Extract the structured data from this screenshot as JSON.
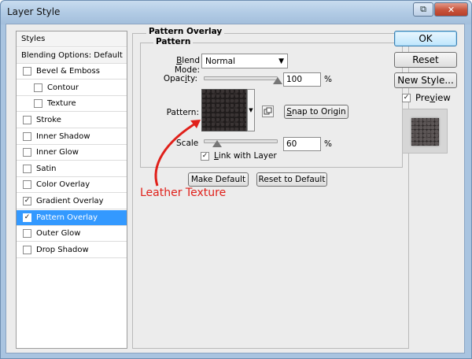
{
  "window": {
    "title": "Layer Style",
    "help_glyph": "⧉",
    "close_glyph": "✕"
  },
  "styles_list": {
    "items": [
      {
        "label": "Styles",
        "type": "header",
        "checked": false
      },
      {
        "label": "Blending Options: Default",
        "type": "header",
        "checked": false
      },
      {
        "label": "Bevel & Emboss",
        "type": "item",
        "checked": false
      },
      {
        "label": "Contour",
        "type": "sub",
        "checked": false
      },
      {
        "label": "Texture",
        "type": "sub",
        "checked": false
      },
      {
        "label": "Stroke",
        "type": "item",
        "checked": false
      },
      {
        "label": "Inner Shadow",
        "type": "item",
        "checked": false
      },
      {
        "label": "Inner Glow",
        "type": "item",
        "checked": false
      },
      {
        "label": "Satin",
        "type": "item",
        "checked": false
      },
      {
        "label": "Color Overlay",
        "type": "item",
        "checked": false
      },
      {
        "label": "Gradient Overlay",
        "type": "item",
        "checked": true
      },
      {
        "label": "Pattern Overlay",
        "type": "item",
        "checked": true,
        "selected": true
      },
      {
        "label": "Outer Glow",
        "type": "item",
        "checked": false
      },
      {
        "label": "Drop Shadow",
        "type": "item",
        "checked": false
      }
    ]
  },
  "pattern_overlay": {
    "title": "Pattern Overlay",
    "group_title": "Pattern",
    "blend_mode_label_prefix": "B",
    "blend_mode_label_rest": "lend Mode:",
    "blend_mode_value": "Normal",
    "opacity_label_prefix": "Opac",
    "opacity_label_u": "i",
    "opacity_label_rest": "ty:",
    "opacity_value": "100",
    "opacity_level": 1.0,
    "opacity_unit": "%",
    "pattern_label": "Pattern:",
    "snap_button_pre": "S",
    "snap_button_rest": "nap to Origin",
    "scale_label": "Scale",
    "scale_value": "60",
    "scale_level": 0.6,
    "scale_unit": "%",
    "link_checked": true,
    "link_label_pre": "L",
    "link_label_rest": "ink with Layer",
    "make_default": "Make Default",
    "reset_to_default": "Reset to Default"
  },
  "right_panel": {
    "ok": "OK",
    "reset": "Reset",
    "new_style": "New Style...",
    "preview_checked": true,
    "preview_label_pre": "Pre",
    "preview_label_u": "v",
    "preview_label_rest": "iew"
  },
  "annotation": {
    "text": "Leather Texture",
    "color": "#e0201a"
  }
}
